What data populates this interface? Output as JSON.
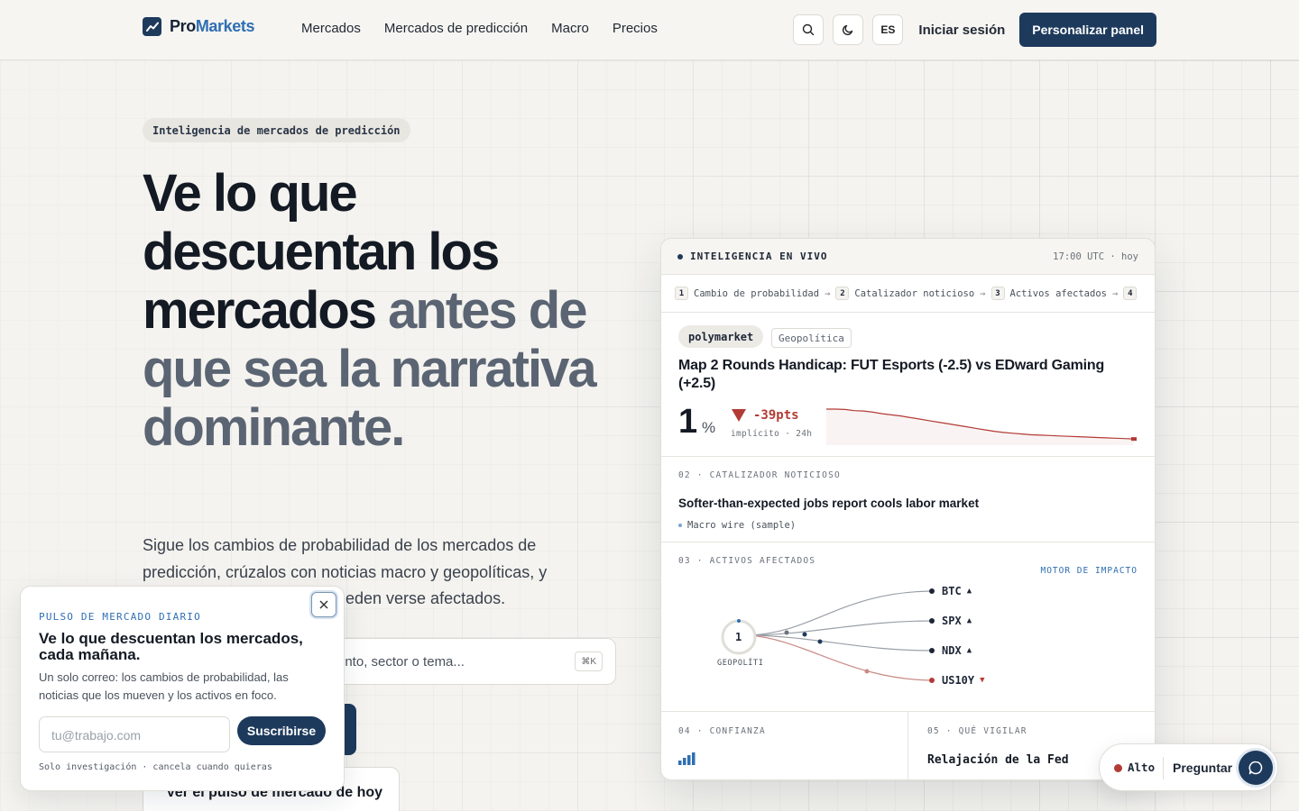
{
  "nav": {
    "brand_pro": "Pro",
    "brand_markets": "Markets",
    "links": [
      "Mercados",
      "Mercados de predicción",
      "Macro",
      "Precios"
    ],
    "lang": "ES",
    "login": "Iniciar sesión",
    "cta": "Personalizar panel"
  },
  "hero": {
    "eyebrow": "Inteligencia de mercados de predicción",
    "title_dark": "Ve lo que descuentan los mercados",
    "title_muted": "antes de que sea la narrativa dominante.",
    "subtitle_visible": "Sigue los cambios de probabilidad de los mercados de predicción, crúzalos con noticias macro y geopolíticas, y",
    "subtitle_partial": "eden verse afectados.",
    "search_placeholder_partial": "ento, sector o tema...",
    "search_kbd": "⌘K",
    "secondary_cta": "Ver el pulso de mercado de hoy"
  },
  "popup": {
    "eyebrow": "PULSO DE MERCADO DIARIO",
    "title": "Ve lo que descuentan los mercados, cada mañana.",
    "body": "Un solo correo: los cambios de probabilidad, las noticias que los mueven y los activos en foco.",
    "email_placeholder": "tu@trabajo.com",
    "subscribe": "Suscribirse",
    "footnote": "Solo investigación · cancela cuando quieras"
  },
  "card": {
    "header_label": "INTELIGENCIA EN VIVO",
    "header_time": "17:00 UTC · hoy",
    "steps": [
      {
        "num": "1",
        "label": "Cambio de probabilidad"
      },
      {
        "num": "2",
        "label": "Catalizador noticioso"
      },
      {
        "num": "3",
        "label": "Activos afectados"
      },
      {
        "num": "4",
        "label": ""
      }
    ],
    "source": "polymarket",
    "category": "Geopolítica",
    "market_title": "Map 2 Rounds Handicap: FUT Esports (-2.5) vs EDward Gaming (+2.5)",
    "probability": "1",
    "probability_unit": "%",
    "delta": "-39pts",
    "delta_meta": "implícito · 24h",
    "sparkline": [
      40,
      40,
      39.5,
      38,
      37.5,
      36,
      34,
      32.5,
      31,
      29,
      27,
      25,
      23,
      21,
      19,
      17,
      15,
      13,
      11,
      9.5,
      8.5,
      7.5,
      6.5,
      6,
      5.5,
      5,
      4.5,
      4,
      3.5,
      3,
      2.5,
      2,
      1.5,
      1
    ],
    "catalyst_label": "02 · CATALIZADOR NOTICIOSO",
    "catalyst_title": "Softer-than-expected jobs report cools labor market",
    "catalyst_source": "Macro wire (sample)",
    "assets_label": "03 · ACTIVOS AFECTADOS",
    "motor_label": "MOTOR DE IMPACTO",
    "node_value": "1",
    "node_label": "GEOPOLÍTI",
    "assets": [
      {
        "name": "BTC",
        "dir": "▲",
        "color": "#1d2636"
      },
      {
        "name": "SPX",
        "dir": "▲",
        "color": "#1d2636"
      },
      {
        "name": "NDX",
        "dir": "▲",
        "color": "#1d2636"
      },
      {
        "name": "US10Y",
        "dir": "▼",
        "color": "#b23b35"
      }
    ],
    "confidence_label": "04 · CONFIANZA",
    "confidence_level": 4,
    "watch_label": "05 · QUÉ VIGILAR",
    "watch_value": "Relajación de la Fed"
  },
  "ask": {
    "level": "Alto",
    "label": "Preguntar"
  },
  "colors": {
    "brand_navy": "#1d3a5c",
    "accent_blue": "#2f6fb3",
    "negative_red": "#b23b35"
  }
}
